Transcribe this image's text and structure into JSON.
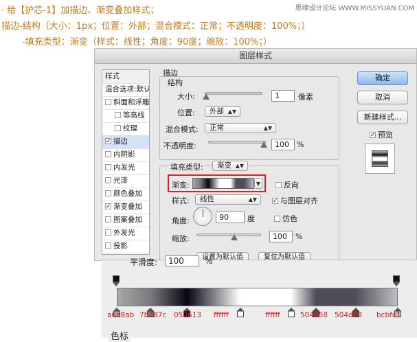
{
  "tutorial": {
    "line1": "· 给【护芯-1】加描边、渐变叠加样式；",
    "line2": "描边-结构（大小：1px；位置：外部；混合模式：正常；不透明度：100%；）",
    "line3": "-填充类型：渐变（样式：线性；角度：90度；缩放：100%；）",
    "watermark": "思缘设计论坛 WWW.MISSYUAN.COM"
  },
  "dialog": {
    "title": "图层样式",
    "style_list": {
      "header": "样式",
      "items": [
        {
          "label": "混合选项:默认",
          "checkbox": false,
          "checked": false,
          "selected": false,
          "indent": 0
        },
        {
          "label": "斜面和浮雕",
          "checkbox": true,
          "checked": false,
          "selected": false,
          "indent": 0
        },
        {
          "label": "等高线",
          "checkbox": true,
          "checked": false,
          "selected": false,
          "indent": 1
        },
        {
          "label": "纹理",
          "checkbox": true,
          "checked": false,
          "selected": false,
          "indent": 1
        },
        {
          "label": "描边",
          "checkbox": true,
          "checked": true,
          "selected": true,
          "indent": 0
        },
        {
          "label": "内阴影",
          "checkbox": true,
          "checked": false,
          "selected": false,
          "indent": 0
        },
        {
          "label": "内发光",
          "checkbox": true,
          "checked": false,
          "selected": false,
          "indent": 0
        },
        {
          "label": "光泽",
          "checkbox": true,
          "checked": false,
          "selected": false,
          "indent": 0
        },
        {
          "label": "颜色叠加",
          "checkbox": true,
          "checked": false,
          "selected": false,
          "indent": 0
        },
        {
          "label": "渐变叠加",
          "checkbox": true,
          "checked": true,
          "selected": false,
          "indent": 0
        },
        {
          "label": "图案叠加",
          "checkbox": true,
          "checked": false,
          "selected": false,
          "indent": 0
        },
        {
          "label": "外发光",
          "checkbox": true,
          "checked": false,
          "selected": false,
          "indent": 0
        },
        {
          "label": "投影",
          "checkbox": true,
          "checked": false,
          "selected": false,
          "indent": 0
        }
      ]
    },
    "stroke": {
      "section_title": "描边",
      "structure_title": "结构",
      "size_label": "大小:",
      "size_value": "1",
      "size_unit": "像素",
      "position_label": "位置:",
      "position_value": "外部",
      "blend_label": "混合模式:",
      "blend_value": "正常",
      "opacity_label": "不透明度:",
      "opacity_value": "100",
      "opacity_unit": "%",
      "fill_type_label": "填充类型:",
      "fill_type_value": "渐变",
      "gradient_label": "渐变:",
      "reverse_label": "反向",
      "style_label": "样式:",
      "style_value": "线性",
      "align_label": "与图层对齐",
      "angle_label": "角度:",
      "angle_value": "90",
      "angle_unit": "度",
      "dither_label": "仿色",
      "scale_label": "缩放:",
      "scale_value": "100",
      "scale_unit": "%",
      "btn_default": "设置为默认值",
      "btn_reset": "复位为默认值"
    },
    "buttons": {
      "ok": "确定",
      "cancel": "取消",
      "new_style": "新建样式...",
      "preview": "预览"
    }
  },
  "gradient_editor": {
    "smoothness_label": "平滑度:",
    "smoothness_value": "100",
    "smoothness_unit": "%",
    "color_section": "色标",
    "stops": [
      {
        "hex": "a6a8ab",
        "color": "#a6a8ab",
        "position": 0.0
      },
      {
        "hex": "7b787c",
        "color": "#7b787c",
        "position": 0.12
      },
      {
        "hex": "050613",
        "color": "#050613",
        "position": 0.25
      },
      {
        "hex": "ffffff",
        "color": "#ffffff",
        "position": 0.44
      },
      {
        "hex": "ffffff",
        "color": "#ffffff",
        "position": 0.62
      },
      {
        "hex": "504d58",
        "color": "#504d58",
        "position": 0.71
      },
      {
        "hex": "504d58",
        "color": "#504d58",
        "position": 0.85
      },
      {
        "hex": "bcbfc1",
        "color": "#bcbfc1",
        "position": 1.0
      }
    ]
  },
  "colors": {
    "highlight_red": "#e02020",
    "label_red": "#d62020",
    "tutorial_orange": "#c87a14",
    "selected_row": "#d3e2f6"
  }
}
